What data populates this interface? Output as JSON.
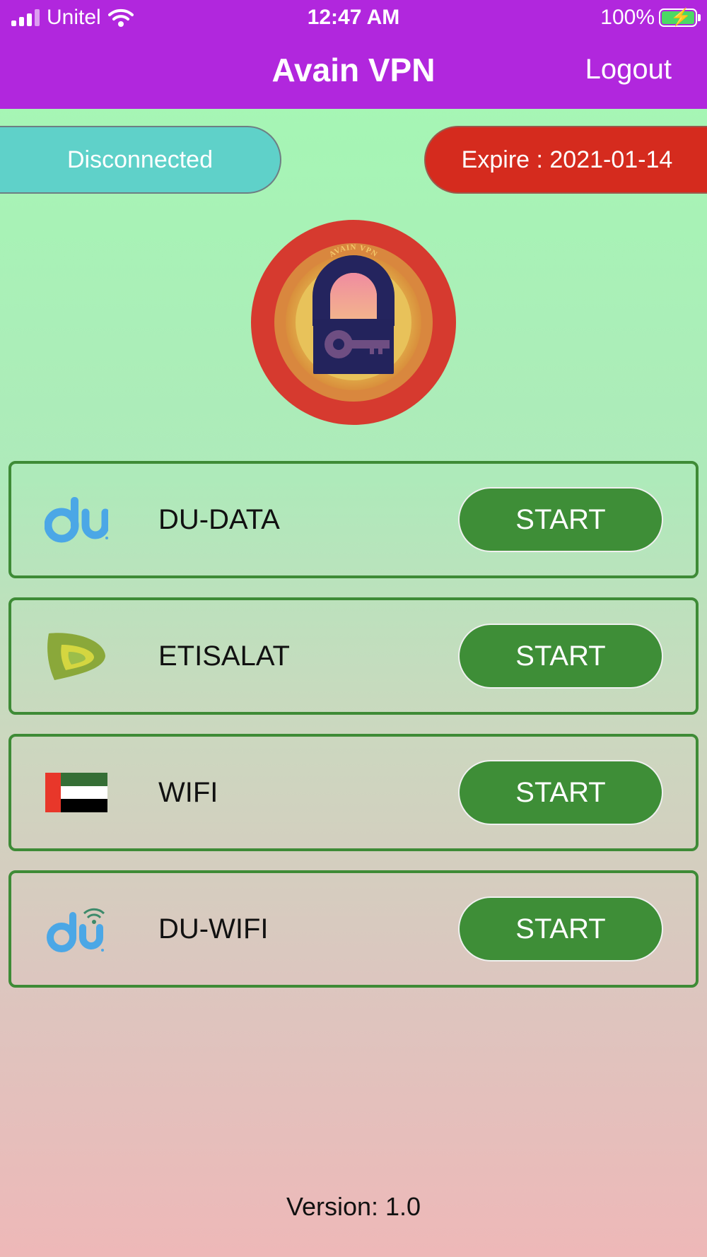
{
  "status_bar": {
    "carrier": "Unitel",
    "time": "12:47 AM",
    "battery": "100%"
  },
  "header": {
    "title": "Avain VPN",
    "logout_label": "Logout"
  },
  "connection": {
    "status": "Disconnected",
    "expire": "Expire : 2021-01-14"
  },
  "logo": {
    "arc_text": "AVAIN VPN"
  },
  "networks": [
    {
      "name": "DU-DATA",
      "icon": "du-logo-icon",
      "button": "START"
    },
    {
      "name": "ETISALAT",
      "icon": "etisalat-logo-icon",
      "button": "START"
    },
    {
      "name": "WIFI",
      "icon": "uae-flag-icon",
      "button": "START"
    },
    {
      "name": "DU-WIFI",
      "icon": "du-wifi-logo-icon",
      "button": "START"
    }
  ],
  "footer": {
    "version": "Version: 1.0"
  },
  "colors": {
    "header": "#b127dd",
    "status_pill": "#5fd1c9",
    "expire_pill": "#d52b1e",
    "button": "#3e8e37",
    "card_border": "#3e8b36"
  }
}
